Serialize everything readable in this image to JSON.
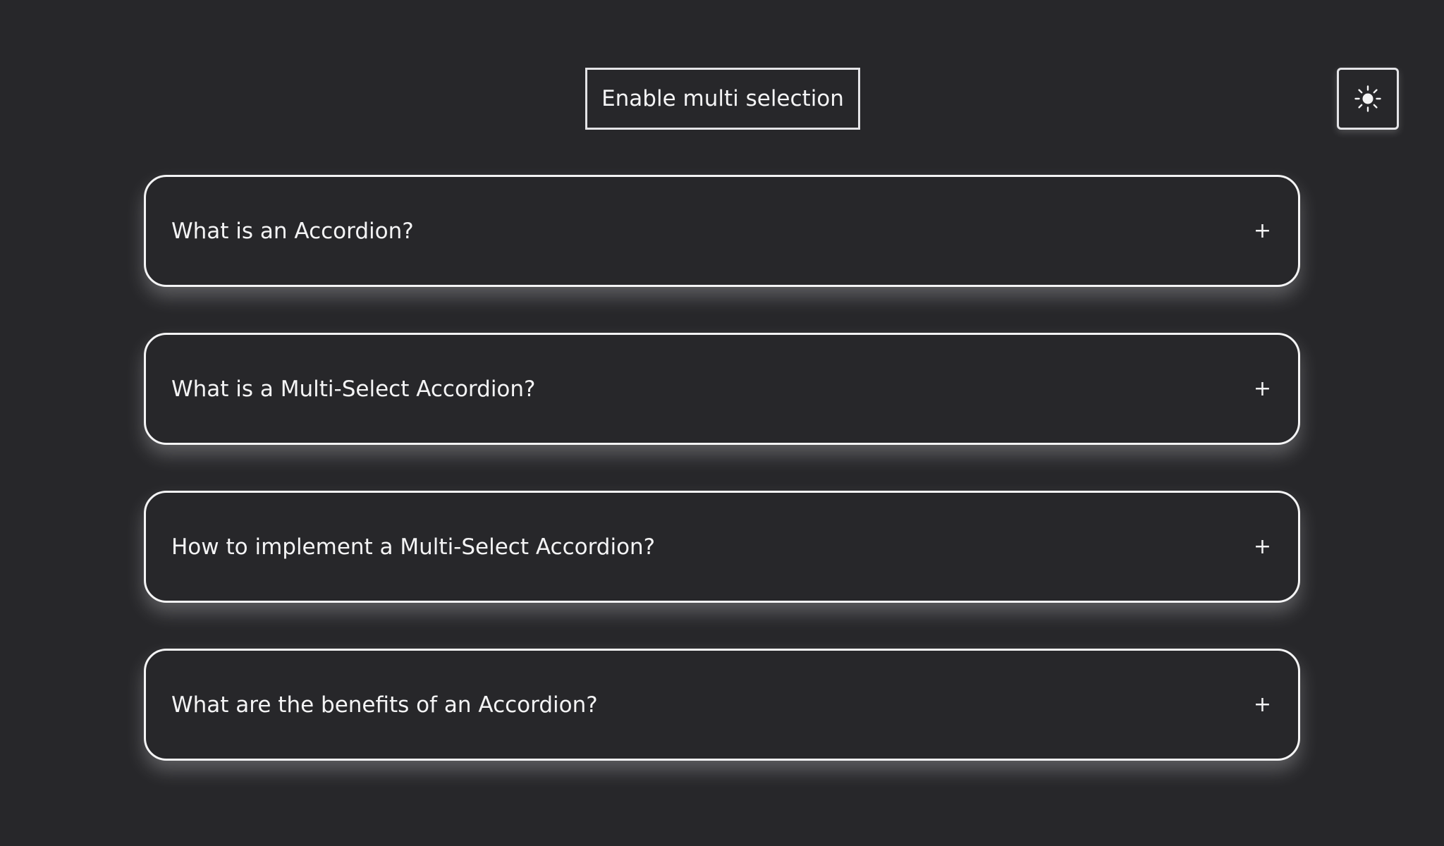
{
  "toolbar": {
    "multi_select_label": "Enable multi selection",
    "theme_toggle_icon": "sun-icon"
  },
  "accordion": {
    "items": [
      {
        "question": "What is an Accordion?",
        "icon": "plus-icon",
        "expand_symbol": "+"
      },
      {
        "question": "What is a Multi-Select Accordion?",
        "icon": "plus-icon",
        "expand_symbol": "+"
      },
      {
        "question": "How to implement a Multi-Select Accordion?",
        "icon": "plus-icon",
        "expand_symbol": "+"
      },
      {
        "question": "What are the benefits of an Accordion?",
        "icon": "plus-icon",
        "expand_symbol": "+"
      }
    ]
  },
  "colors": {
    "background": "#27272a",
    "border": "#f4f4f5",
    "text": "#f4f4f5"
  }
}
